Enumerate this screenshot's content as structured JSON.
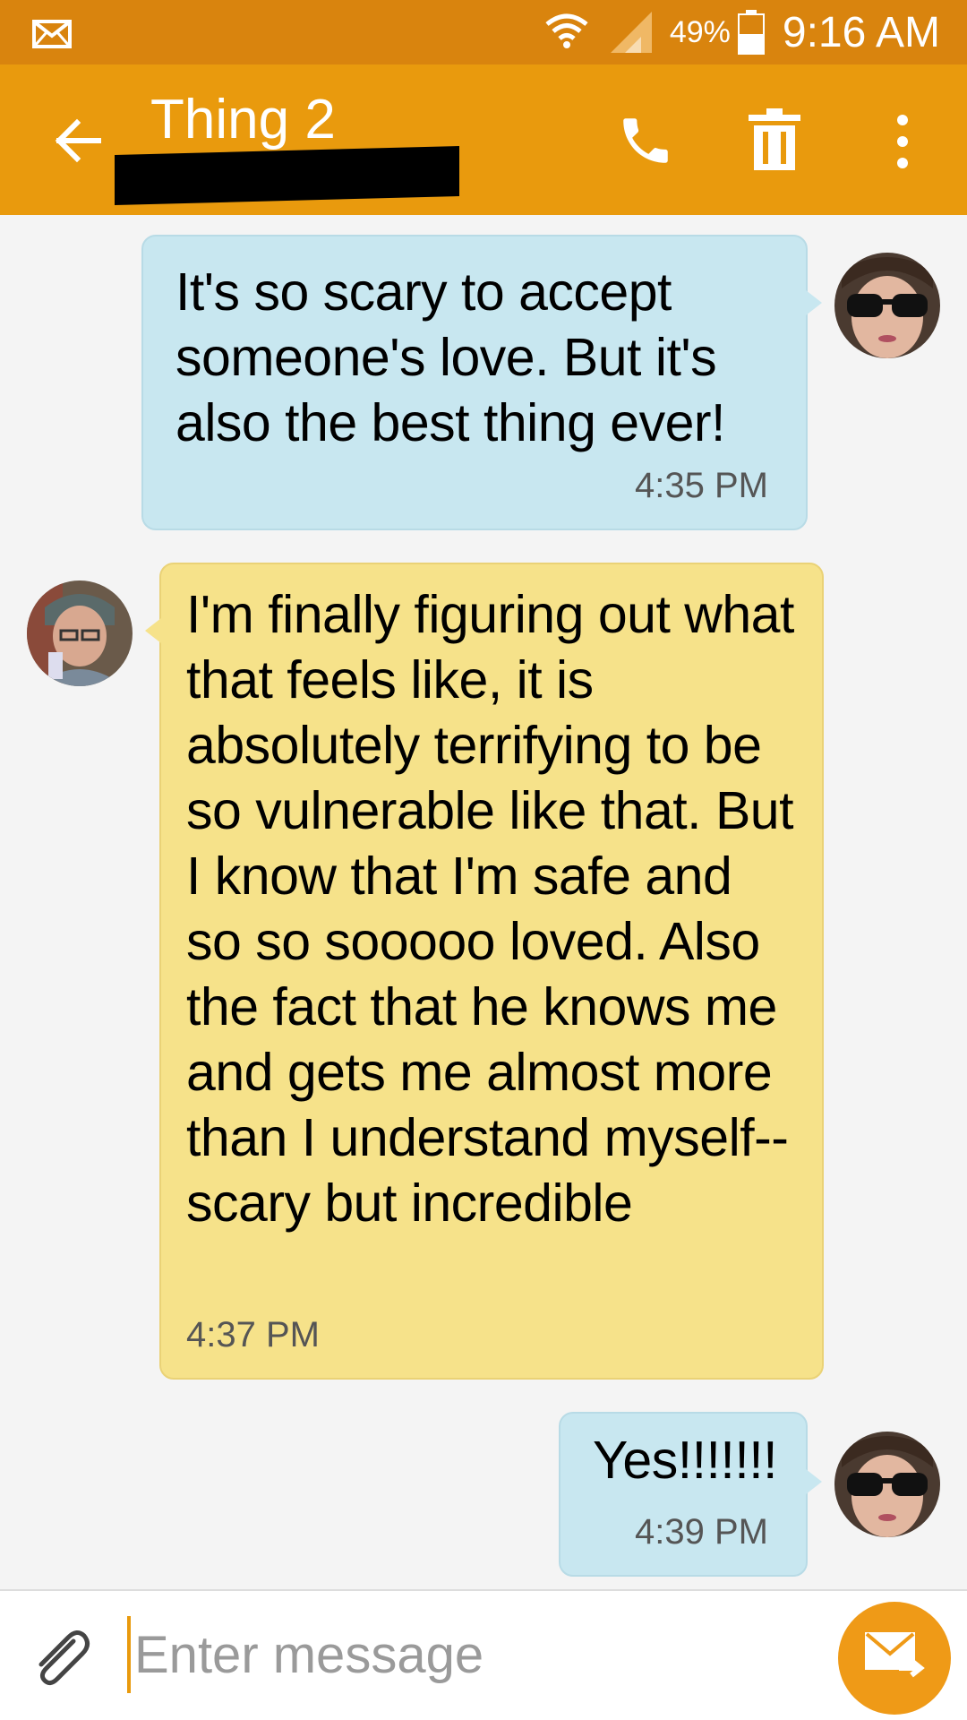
{
  "status_bar": {
    "battery_percent": "49%",
    "time": "9:16 AM",
    "icons": [
      "mail-icon",
      "wifi-icon",
      "signal-icon",
      "battery-icon"
    ]
  },
  "header": {
    "contact_name": "Thing 2",
    "actions": [
      "back-arrow-icon",
      "phone-icon",
      "trash-icon",
      "more-vert-icon"
    ],
    "accent_color": "#e99a0d",
    "status_bar_color": "#d9840e"
  },
  "messages": [
    {
      "direction": "outgoing",
      "text": "It's so scary to accept someone's love. But it's also the best thing ever!",
      "time": "4:35 PM"
    },
    {
      "direction": "incoming",
      "text": "I'm finally figuring out what that feels like, it is absolutely terrifying to be so vulnerable like that. But I know that I'm safe and so so sooooo loved. Also the fact that he knows me and gets me almost more than I understand myself-- scary but incredible",
      "time": "4:37 PM"
    },
    {
      "direction": "outgoing",
      "text": "Yes!!!!!!!",
      "time": "4:39 PM"
    }
  ],
  "composer": {
    "placeholder": "Enter message",
    "attach_icon": "paperclip-icon",
    "send_icon": "send-mail-icon"
  },
  "colors": {
    "outgoing_bubble": "#c8e7f0",
    "incoming_bubble": "#f6e28a"
  }
}
